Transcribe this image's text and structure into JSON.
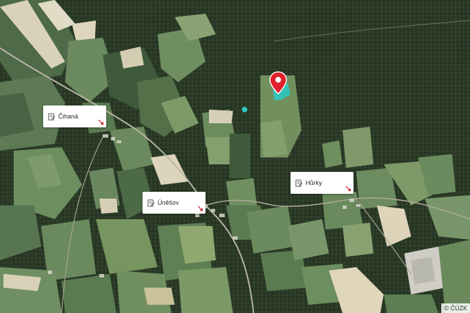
{
  "map": {
    "places": [
      {
        "name": "Čihaná",
        "icon": "document-edit-icon",
        "pointer": "arrow-down-right-icon"
      },
      {
        "name": "Úněšov",
        "icon": "document-edit-icon",
        "pointer": "arrow-down-right-icon"
      },
      {
        "name": "Hůrky",
        "icon": "document-edit-icon",
        "pointer": "arrow-down-right-icon"
      }
    ],
    "marker": {
      "icon": "location-pin-icon",
      "color": "#e0202a"
    },
    "selection_color": "#2ec7c0",
    "copyright": "© ČÚZK"
  }
}
